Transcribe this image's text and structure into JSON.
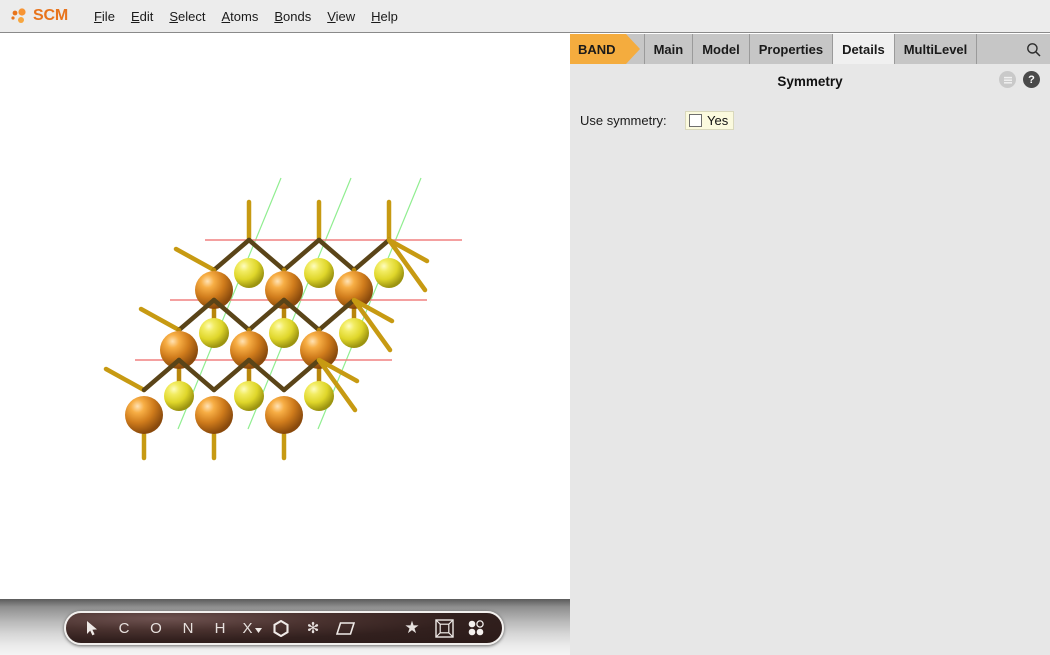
{
  "app": {
    "brand": "SCM",
    "brand_color": "#E8741C"
  },
  "menubar": {
    "items": [
      {
        "label": "File",
        "mnemonic": "F"
      },
      {
        "label": "Edit",
        "mnemonic": "E"
      },
      {
        "label": "Select",
        "mnemonic": "S"
      },
      {
        "label": "Atoms",
        "mnemonic": "A"
      },
      {
        "label": "Bonds",
        "mnemonic": "B"
      },
      {
        "label": "View",
        "mnemonic": "V"
      },
      {
        "label": "Help",
        "mnemonic": "H"
      }
    ]
  },
  "panel": {
    "program_tab": "BAND",
    "tabs": [
      {
        "label": "Main",
        "selected": false
      },
      {
        "label": "Model",
        "selected": false
      },
      {
        "label": "Properties",
        "selected": false
      },
      {
        "label": "Details",
        "selected": true
      },
      {
        "label": "MultiLevel",
        "selected": false
      }
    ],
    "search_icon": "search-icon",
    "section_title": "Symmetry",
    "header_icons": [
      {
        "name": "menu-icon",
        "glyph": "≡"
      },
      {
        "name": "help-icon",
        "glyph": "?"
      }
    ],
    "fields": [
      {
        "label": "Use symmetry:",
        "control": "checkbox",
        "value_label": "Yes",
        "checked": false
      }
    ],
    "accent_color": "#f4ac3e",
    "tab_selected_bg": "#f0f0f0",
    "background": "#e7e7e7"
  },
  "toolbar": {
    "tools": [
      {
        "name": "select-cursor-tool",
        "glyph": "➤",
        "kind": "cursor"
      },
      {
        "name": "carbon-atom-tool",
        "glyph": "C",
        "kind": "text"
      },
      {
        "name": "oxygen-atom-tool",
        "glyph": "O",
        "kind": "text"
      },
      {
        "name": "nitrogen-atom-tool",
        "glyph": "N",
        "kind": "text"
      },
      {
        "name": "hydrogen-atom-tool",
        "glyph": "H",
        "kind": "text"
      },
      {
        "name": "other-element-tool",
        "glyph": "X",
        "kind": "dropdown"
      },
      {
        "name": "benzene-ring-tool",
        "glyph": "⬡",
        "kind": "shape"
      },
      {
        "name": "fragment-tool",
        "glyph": "✻",
        "kind": "shape"
      },
      {
        "name": "plane-tool",
        "glyph": "▱",
        "kind": "shape"
      },
      {
        "name": "favorites-tool",
        "glyph": "★",
        "kind": "shape"
      },
      {
        "name": "unit-cell-tool",
        "glyph": "⧉",
        "kind": "shape"
      },
      {
        "name": "periodic-dots-tool",
        "glyph": "dots",
        "kind": "dots"
      }
    ]
  },
  "structure": {
    "description": "2D periodic slab lattice, alternating two atom types",
    "atom_colors": {
      "type_a": "#D4801E",
      "type_a_highlight": "#FFD190",
      "type_b": "#E8E23A",
      "type_b_highlight": "#FDFBB0"
    },
    "bond_color": "#B8860B",
    "dangling_bond_color": "#C79A12",
    "lattice_vector_a_color": "#F08080",
    "lattice_vector_b_color": "#90EE90",
    "viewport_background": "#ffffff"
  }
}
